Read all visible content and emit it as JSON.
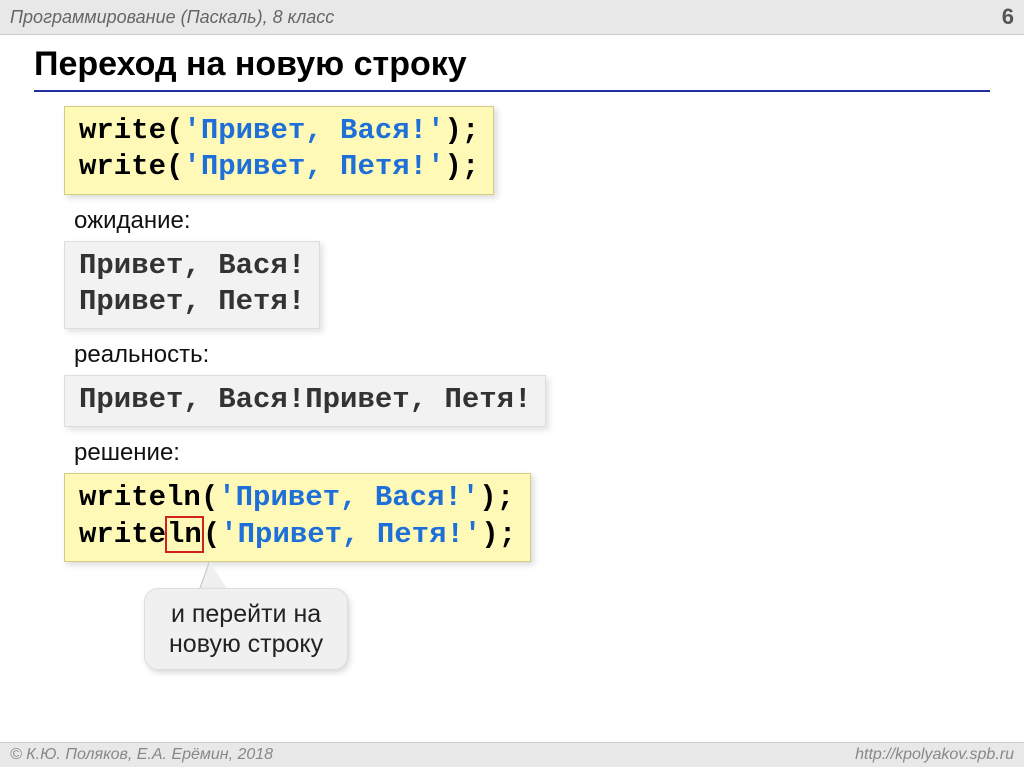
{
  "header": {
    "course": "Программирование (Паскаль), 8 класс",
    "page": "6"
  },
  "title": "Переход на новую строку",
  "code1": {
    "lines": [
      {
        "kw": "write",
        "open": "(",
        "q1": "'",
        "str": "Привет, Вася!",
        "q2": "'",
        "close": ")",
        "semi": ";"
      },
      {
        "kw": "write",
        "open": "(",
        "q1": "'",
        "str": "Привет, Петя!",
        "q2": "'",
        "close": ")",
        "semi": ";"
      }
    ]
  },
  "labels": {
    "expect": "ожидание:",
    "reality": "реальность:",
    "solution": "решение:"
  },
  "expected_output": [
    "Привет, Вася!",
    "Привет, Петя!"
  ],
  "real_output": "Привет, Вася!Привет, Петя!",
  "code2": {
    "lines": [
      {
        "kw": "write",
        "ln": "ln",
        "open": "(",
        "q1": "'",
        "str": "Привет, Вася!",
        "q2": "'",
        "close": ")",
        "semi": ";"
      },
      {
        "kw": "write",
        "ln": "ln",
        "open": "(",
        "q1": "'",
        "str": "Привет, Петя!",
        "q2": "'",
        "close": ")",
        "semi": ";"
      }
    ]
  },
  "callout": {
    "line1": "и перейти на",
    "line2": "новую строку"
  },
  "footer": {
    "left": "© К.Ю. Поляков, Е.А. Ерёмин, 2018",
    "right": "http://kpolyakov.spb.ru"
  }
}
